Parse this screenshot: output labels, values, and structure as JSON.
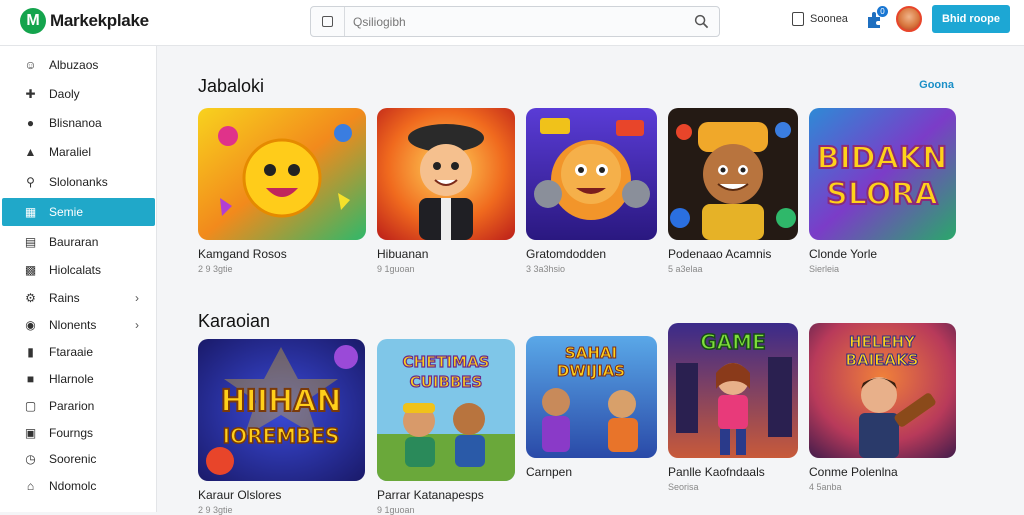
{
  "app": {
    "name": "Markekplake",
    "logo_letter": "M"
  },
  "search": {
    "placeholder": "Qsiliogibh"
  },
  "header": {
    "link_label": "Soonea",
    "notif_count": "0",
    "cta_label": "Bhid roope"
  },
  "sidebar": {
    "items": [
      {
        "label": "Albuzaos",
        "icon": "person-icon",
        "active": false
      },
      {
        "label": "Daoly",
        "icon": "plus-icon",
        "active": false
      },
      {
        "label": "Blisnanoa",
        "icon": "circle-icon",
        "active": false
      },
      {
        "label": "Maraliel",
        "icon": "triangle-icon",
        "active": false
      },
      {
        "label": "Slolonanks",
        "icon": "search-icon",
        "active": false
      },
      {
        "label": "Semie",
        "icon": "grid-icon",
        "active": true
      },
      {
        "label": "Bauraran",
        "icon": "list-icon",
        "active": false
      },
      {
        "label": "Hiolcalats",
        "icon": "chart-icon",
        "active": false
      },
      {
        "label": "Rains",
        "icon": "gear-icon",
        "active": false,
        "has_chevron": true
      },
      {
        "label": "Nlonents",
        "icon": "shield-icon",
        "active": false,
        "has_chevron": true
      },
      {
        "label": "Ftaraaie",
        "icon": "bars-icon",
        "active": false
      },
      {
        "label": "Hlarnole",
        "icon": "square-icon",
        "active": false
      },
      {
        "label": "Pararion",
        "icon": "doc-icon",
        "active": false
      },
      {
        "label": "Fourngs",
        "icon": "folder-icon",
        "active": false
      },
      {
        "label": "Soorenic",
        "icon": "clock-icon",
        "active": false
      },
      {
        "label": "Ndomolc",
        "icon": "home-icon",
        "active": false
      }
    ]
  },
  "sections": [
    {
      "title": "Jabaloki",
      "more_label": "Goona",
      "cards": [
        {
          "title": "Kamgand Rosos",
          "sub": "2 9 3gtie"
        },
        {
          "title": "Hibuanan",
          "sub": "9 1guoan"
        },
        {
          "title": "Gratomdodden",
          "sub": "3 3a3hsio"
        },
        {
          "title": "Podenaao Acamnis",
          "sub": "5 a3elaa"
        },
        {
          "title": "Clonde Yorle",
          "sub": "Sierleia"
        }
      ]
    },
    {
      "title": "Karaoian",
      "cards": [
        {
          "title": "Karaur Olslores",
          "sub": "2 9 3gtie"
        },
        {
          "title": "Parrar Katanapesps",
          "sub": "9 1guoan"
        },
        {
          "title": "Carnpen",
          "sub": ""
        },
        {
          "title": "Panlle Kaofndaals",
          "sub": "Seorisa"
        },
        {
          "title": "Conme Polenlna",
          "sub": "4 5anba"
        }
      ]
    }
  ],
  "thumb_text": {
    "card_4": [
      "BIDAKN",
      "SLORA"
    ],
    "card_6": [
      "HIIHAN",
      "IOREMBES"
    ],
    "card_7": [
      "CHETIMAS",
      "CUIBBES"
    ],
    "card_8": [
      "SAHAI",
      "DWIJIAS"
    ],
    "card_9": [
      "GAME"
    ],
    "card_10": [
      "HELEHY",
      "BAIEAKS"
    ]
  },
  "colors": {
    "accent": "#20a8c9",
    "cta": "#1da7d4",
    "logo": "#14a44d",
    "link": "#1a8fc7"
  }
}
